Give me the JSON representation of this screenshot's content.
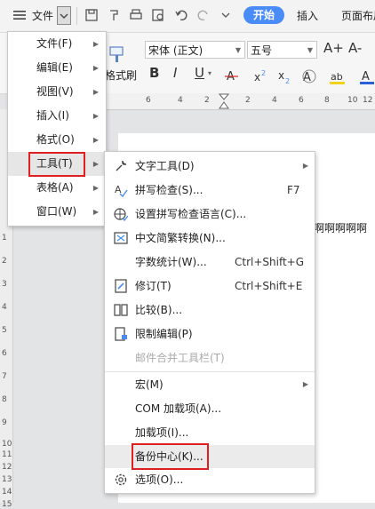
{
  "topbar": {
    "file_label": "文件",
    "tabs": [
      "开始",
      "插入",
      "页面布局"
    ]
  },
  "ribbon": {
    "font_name": "宋体 (正文)",
    "font_size": "五号",
    "format_brush": "格式刷",
    "bold": "B",
    "italic": "I",
    "underline": "U",
    "font_grow": "A+",
    "font_shrink": "A-"
  },
  "document": {
    "text": "啊啊啊啊啊"
  },
  "ruler": {
    "h_ticks": [
      "6",
      "4",
      "2",
      "2",
      "4",
      "6",
      "8",
      "10",
      "12"
    ],
    "v_ticks": [
      "1",
      "2",
      "3",
      "4",
      "5",
      "6",
      "7",
      "8",
      "9",
      "10",
      "11",
      "12",
      "13",
      "14",
      "15"
    ]
  },
  "main_menu": {
    "items": [
      {
        "label": "文件(F)"
      },
      {
        "label": "编辑(E)"
      },
      {
        "label": "视图(V)"
      },
      {
        "label": "插入(I)"
      },
      {
        "label": "格式(O)"
      },
      {
        "label": "工具(T)"
      },
      {
        "label": "表格(A)"
      },
      {
        "label": "窗口(W)"
      }
    ]
  },
  "tools_menu": {
    "items": [
      {
        "label": "文字工具(D)",
        "shortcut": ""
      },
      {
        "label": "拼写检查(S)...",
        "shortcut": "F7"
      },
      {
        "label": "设置拼写检查语言(C)...",
        "shortcut": ""
      },
      {
        "label": "中文简繁转换(N)...",
        "shortcut": ""
      },
      {
        "label": "字数统计(W)...",
        "shortcut": "Ctrl+Shift+G"
      },
      {
        "label": "修订(T)",
        "shortcut": "Ctrl+Shift+E"
      },
      {
        "label": "比较(B)...",
        "shortcut": ""
      },
      {
        "label": "限制编辑(P)",
        "shortcut": ""
      },
      {
        "label": "邮件合并工具栏(T)",
        "shortcut": ""
      },
      {
        "label": "宏(M)",
        "shortcut": ""
      },
      {
        "label": "COM 加载项(A)...",
        "shortcut": ""
      },
      {
        "label": "加载项(I)...",
        "shortcut": ""
      },
      {
        "label": "备份中心(K)...",
        "shortcut": ""
      },
      {
        "label": "选项(O)...",
        "shortcut": ""
      }
    ]
  },
  "colors": {
    "accent": "#4a8cf7",
    "highlight_box": "#e02020",
    "hover_row": "#ebebeb"
  }
}
